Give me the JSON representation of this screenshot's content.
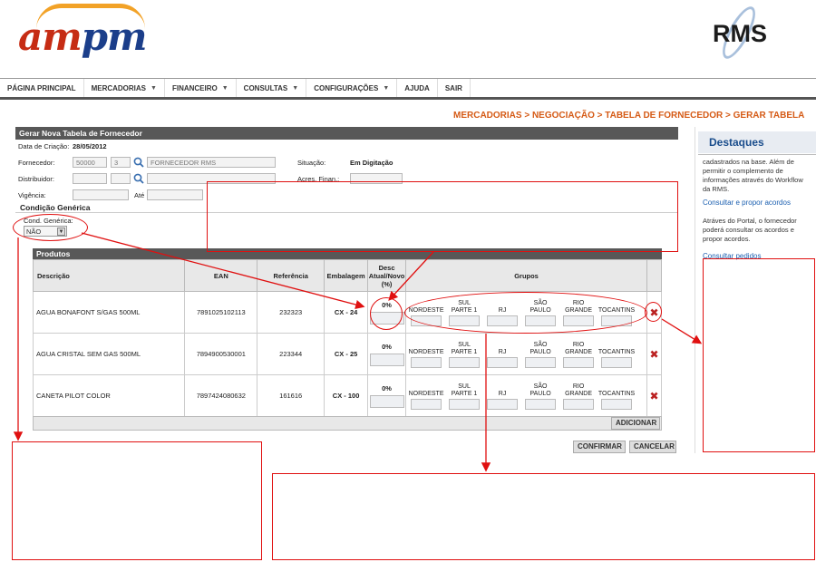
{
  "header": {
    "logo_left_a": "am",
    "logo_left_b": "pm",
    "logo_right": "RMS"
  },
  "nav": {
    "items": [
      {
        "label": "PÁGINA PRINCIPAL",
        "dropdown": false
      },
      {
        "label": "MERCADORIAS",
        "dropdown": true
      },
      {
        "label": "FINANCEIRO",
        "dropdown": true
      },
      {
        "label": "CONSULTAS",
        "dropdown": true
      },
      {
        "label": "CONFIGURAÇÕES",
        "dropdown": true
      },
      {
        "label": "AJUDA",
        "dropdown": false
      },
      {
        "label": "SAIR",
        "dropdown": false
      }
    ],
    "caret": "▼"
  },
  "breadcrumb": "MERCADORIAS > NEGOCIAÇÃO > TABELA DE FORNECEDOR > GERAR TABELA",
  "form": {
    "title": "Gerar Nova Tabela de Fornecedor",
    "creation_label": "Data de Criação:",
    "creation_value": "28/05/2012",
    "supplier_label": "Fornecedor:",
    "supplier_code": "50000",
    "supplier_digit": "3",
    "supplier_name": "FORNECEDOR RMS",
    "status_label": "Situação:",
    "status_value": "Em Digitação",
    "distributor_label": "Distribuidor:",
    "financial_label": "Acres. Finan.:",
    "validity_label": "Vigência:",
    "until_label": "Até",
    "generic_condition_heading": "Condição Genérica",
    "generic_condition_label": "Cond. Genérica:",
    "generic_condition_value": "NÃO"
  },
  "products": {
    "title": "Produtos",
    "columns": {
      "description": "Descrição",
      "ean": "EAN",
      "reference": "Referência",
      "packaging": "Embalagem",
      "discount": "Desc Atual/Novo (%)",
      "groups": "Grupos"
    },
    "group_labels": [
      "NORDESTE",
      "SUL PARTE 1",
      "RJ",
      "SÃO PAULO",
      "RIO GRANDE",
      "TOCANTINS"
    ],
    "rows": [
      {
        "description": "AGUA BONAFONT S/GAS 500ML",
        "ean": "7891025102113",
        "reference": "232323",
        "packaging": "CX - 24",
        "discount": "0%"
      },
      {
        "description": "AGUA CRISTAL SEM GAS 500ML",
        "ean": "7894900530001",
        "reference": "223344",
        "packaging": "CX - 25",
        "discount": "0%"
      },
      {
        "description": "CANETA PILOT COLOR",
        "ean": "7897424080632",
        "reference": "161616",
        "packaging": "CX - 100",
        "discount": "0%"
      }
    ],
    "delete_glyph": "✖",
    "add_label": "ADICIONAR"
  },
  "actions": {
    "confirm_label": "CONFIRMAR",
    "cancel_label": "CANCELAR"
  },
  "sidebar": {
    "title": "Destaques",
    "intro_text": "cadastrados na base. Além de permitir o complemento de informações através do Workflow da RMS.",
    "link1": "Consultar e propor acordos",
    "text1": "Atráves do Portal, o fornecedor poderá consultar os acordos e propor acordos.",
    "link2": "Consultar pedidos"
  },
  "colors": {
    "brand_red": "#c62c14",
    "brand_blue": "#1b3e8a",
    "brand_orange": "#f2a227",
    "breadcrumb": "#d55a15",
    "annotation_red": "#e01010",
    "panel_header": "#585858",
    "sidebar_title": "#1a4d8c"
  }
}
